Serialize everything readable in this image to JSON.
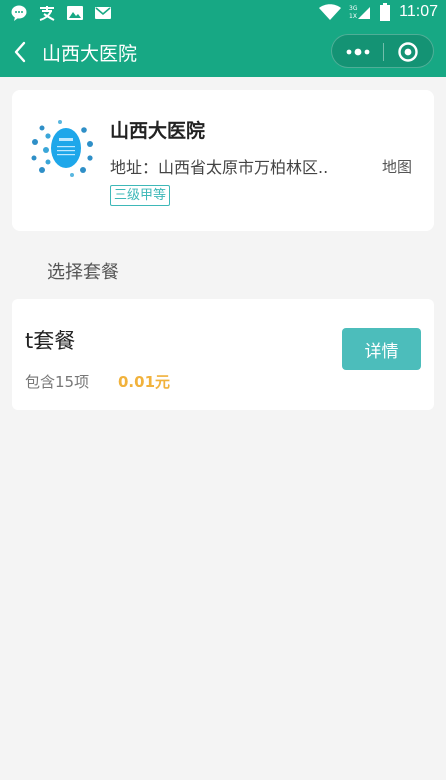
{
  "status_bar": {
    "time": "11:07",
    "left_icons": [
      "chat-bubble-icon",
      "alipay-icon",
      "image-icon",
      "mail-icon"
    ],
    "right_icons": [
      "wifi-icon",
      "signal-icon",
      "battery-icon"
    ],
    "network_labels": [
      "3G",
      "1X"
    ]
  },
  "nav": {
    "title": "山西大医院",
    "back_icon": "chevron-left-icon",
    "more_icon": "more-dots-icon",
    "close_icon": "target-close-icon"
  },
  "hospital": {
    "name": "山西大医院",
    "address": "地址：山西省太原市万柏林区..",
    "map_label": "地图",
    "level": "三级甲等"
  },
  "section": {
    "title": "选择套餐"
  },
  "packages": [
    {
      "name": "t套餐",
      "count": "包含15项",
      "price": "0.01元",
      "detail_label": "详情"
    }
  ],
  "colors": {
    "brand": "#17a884",
    "button": "#4cbdbb",
    "badge": "#3eb8b8",
    "price": "#f1b23c",
    "background": "#f4f4f4"
  }
}
